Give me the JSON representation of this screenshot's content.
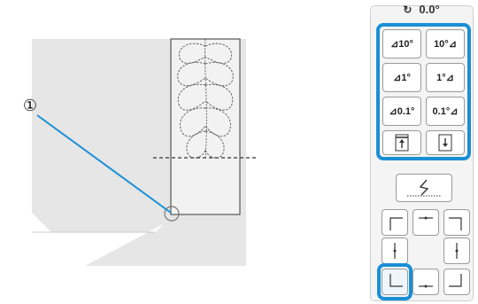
{
  "callout": {
    "number": "①"
  },
  "rotation": {
    "readout": "0.0°",
    "icon": "rotate-icon"
  },
  "rotate_buttons": [
    {
      "name": "rotate-left-10-button",
      "label": "10°",
      "direction": "left"
    },
    {
      "name": "rotate-right-10-button",
      "label": "10°",
      "direction": "right"
    },
    {
      "name": "rotate-left-1-button",
      "label": "1°",
      "direction": "left"
    },
    {
      "name": "rotate-right-1-button",
      "label": "1°",
      "direction": "right"
    },
    {
      "name": "rotate-left-0.1-button",
      "label": "0.1°",
      "direction": "left"
    },
    {
      "name": "rotate-right-0.1-button",
      "label": "0.1°",
      "direction": "right"
    }
  ],
  "icons": {
    "move_up": "arrow-up-frame-icon",
    "move_down": "arrow-down-frame-icon",
    "stitch_line": "zigzag-stitch-icon",
    "corner_top_left": "corner-top-left-icon",
    "edge_top_center": "edge-top-center-icon",
    "corner_top_right": "corner-top-right-icon",
    "edge_middle_left": "edge-middle-left-icon",
    "edge_middle_right": "edge-middle-right-icon",
    "corner_bottom_left": "corner-bottom-left-icon",
    "edge_bottom_center": "edge-bottom-center-icon",
    "corner_bottom_right": "corner-bottom-right-icon"
  },
  "colors": {
    "highlight": "#1a8fd6",
    "callout_line": "#1a8fd6",
    "fabric": "#e6e6e6"
  }
}
